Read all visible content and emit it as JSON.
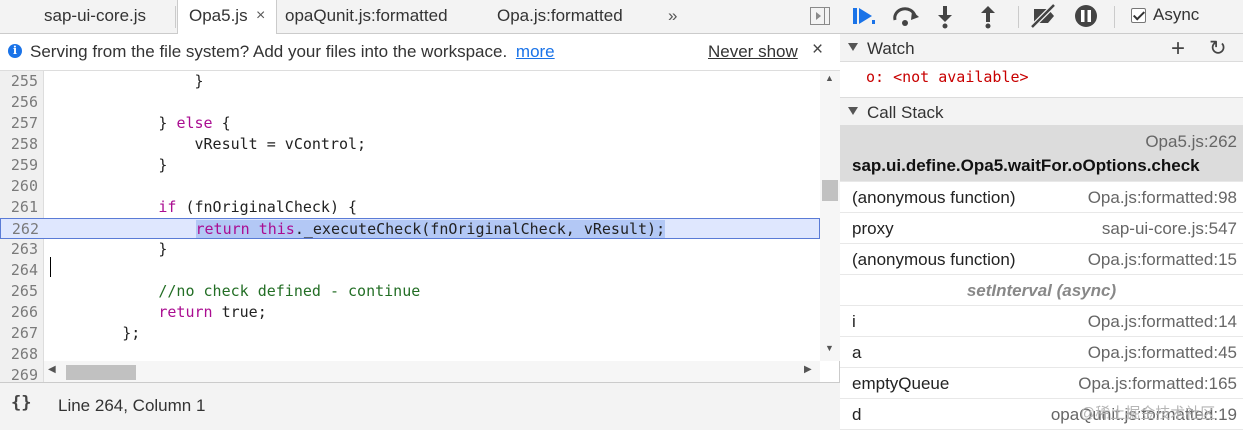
{
  "tabs": [
    {
      "label": "sap-ui-core.js",
      "active": false
    },
    {
      "label": "Opa5.js",
      "active": true,
      "close": "×"
    },
    {
      "label": "opaQunit.js:formatted",
      "active": false
    },
    {
      "label": "Opa.js:formatted",
      "active": false
    }
  ],
  "tab_overflow": "»",
  "infobar": {
    "icon": "i",
    "message": "Serving from the file system? Add your files into the workspace.",
    "more_link": "more",
    "never_show": "Never show",
    "close": "×"
  },
  "editor": {
    "lines": [
      {
        "n": "255",
        "html_parts": [
          {
            "t": "                }",
            "c": ""
          }
        ]
      },
      {
        "n": "256",
        "html_parts": [
          {
            "t": "",
            "c": ""
          }
        ]
      },
      {
        "n": "257",
        "html_parts": [
          {
            "t": "            } ",
            "c": ""
          },
          {
            "t": "else",
            "c": "kw"
          },
          {
            "t": " {",
            "c": ""
          }
        ]
      },
      {
        "n": "258",
        "html_parts": [
          {
            "t": "                vResult = vControl;",
            "c": ""
          }
        ]
      },
      {
        "n": "259",
        "html_parts": [
          {
            "t": "            }",
            "c": ""
          }
        ]
      },
      {
        "n": "260",
        "html_parts": [
          {
            "t": "",
            "c": ""
          }
        ]
      },
      {
        "n": "261",
        "html_parts": [
          {
            "t": "            ",
            "c": ""
          },
          {
            "t": "if",
            "c": "kw"
          },
          {
            "t": " (fnOriginalCheck) {",
            "c": ""
          }
        ]
      },
      {
        "n": "262",
        "current": true,
        "html_parts": [
          {
            "t": "                ",
            "c": ""
          },
          {
            "t": "return",
            "c": "kw sel"
          },
          {
            "t": " ",
            "c": "sel"
          },
          {
            "t": "this",
            "c": "kw sel"
          },
          {
            "t": "._executeCheck(fnOriginalCheck, vResult);",
            "c": "sel"
          }
        ]
      },
      {
        "n": "263",
        "html_parts": [
          {
            "t": "            }",
            "c": ""
          }
        ]
      },
      {
        "n": "264",
        "html_parts": [
          {
            "t": "",
            "c": ""
          }
        ]
      },
      {
        "n": "265",
        "html_parts": [
          {
            "t": "            ",
            "c": ""
          },
          {
            "t": "//no check defined - continue",
            "c": "cm"
          }
        ]
      },
      {
        "n": "266",
        "html_parts": [
          {
            "t": "            ",
            "c": ""
          },
          {
            "t": "return",
            "c": "kw"
          },
          {
            "t": " true;",
            "c": ""
          }
        ]
      },
      {
        "n": "267",
        "html_parts": [
          {
            "t": "        };",
            "c": ""
          }
        ]
      },
      {
        "n": "268",
        "html_parts": [
          {
            "t": "",
            "c": ""
          }
        ]
      },
      {
        "n": "269",
        "html_parts": [
          {
            "t": "",
            "c": ""
          }
        ]
      }
    ]
  },
  "statusbar": {
    "pretty_print": "{}",
    "position": "Line 264, Column 1"
  },
  "debugger": {
    "async_label": "Async",
    "async_checked": true
  },
  "watch": {
    "title": "Watch",
    "add": "+",
    "refresh": "↻",
    "expression": "o: <not available>"
  },
  "call_stack": {
    "title": "Call Stack",
    "frames": [
      {
        "fn": "sap.ui.define.Opa5.waitFor.oOptions.check",
        "loc": "Opa5.js:262",
        "selected": true
      },
      {
        "fn": "(anonymous function)",
        "loc": "Opa.js:formatted:98"
      },
      {
        "fn": "proxy",
        "loc": "sap-ui-core.js:547"
      },
      {
        "fn": "(anonymous function)",
        "loc": "Opa.js:formatted:15"
      },
      {
        "async": "setInterval (async)"
      },
      {
        "fn": "i",
        "loc": "Opa.js:formatted:14"
      },
      {
        "fn": "a",
        "loc": "Opa.js:formatted:45"
      },
      {
        "fn": "emptyQueue",
        "loc": "Opa.js:formatted:165"
      },
      {
        "fn": "d",
        "loc": "opaQunit.js:formatted:19"
      }
    ]
  },
  "watermark": "@稀土掘金技术社区",
  "colors": {
    "keyword": "#aa0d91",
    "comment": "#236e25",
    "link": "#1a73e8",
    "watch_value": "#c80000",
    "debugger_blue": "#1a73e8"
  }
}
